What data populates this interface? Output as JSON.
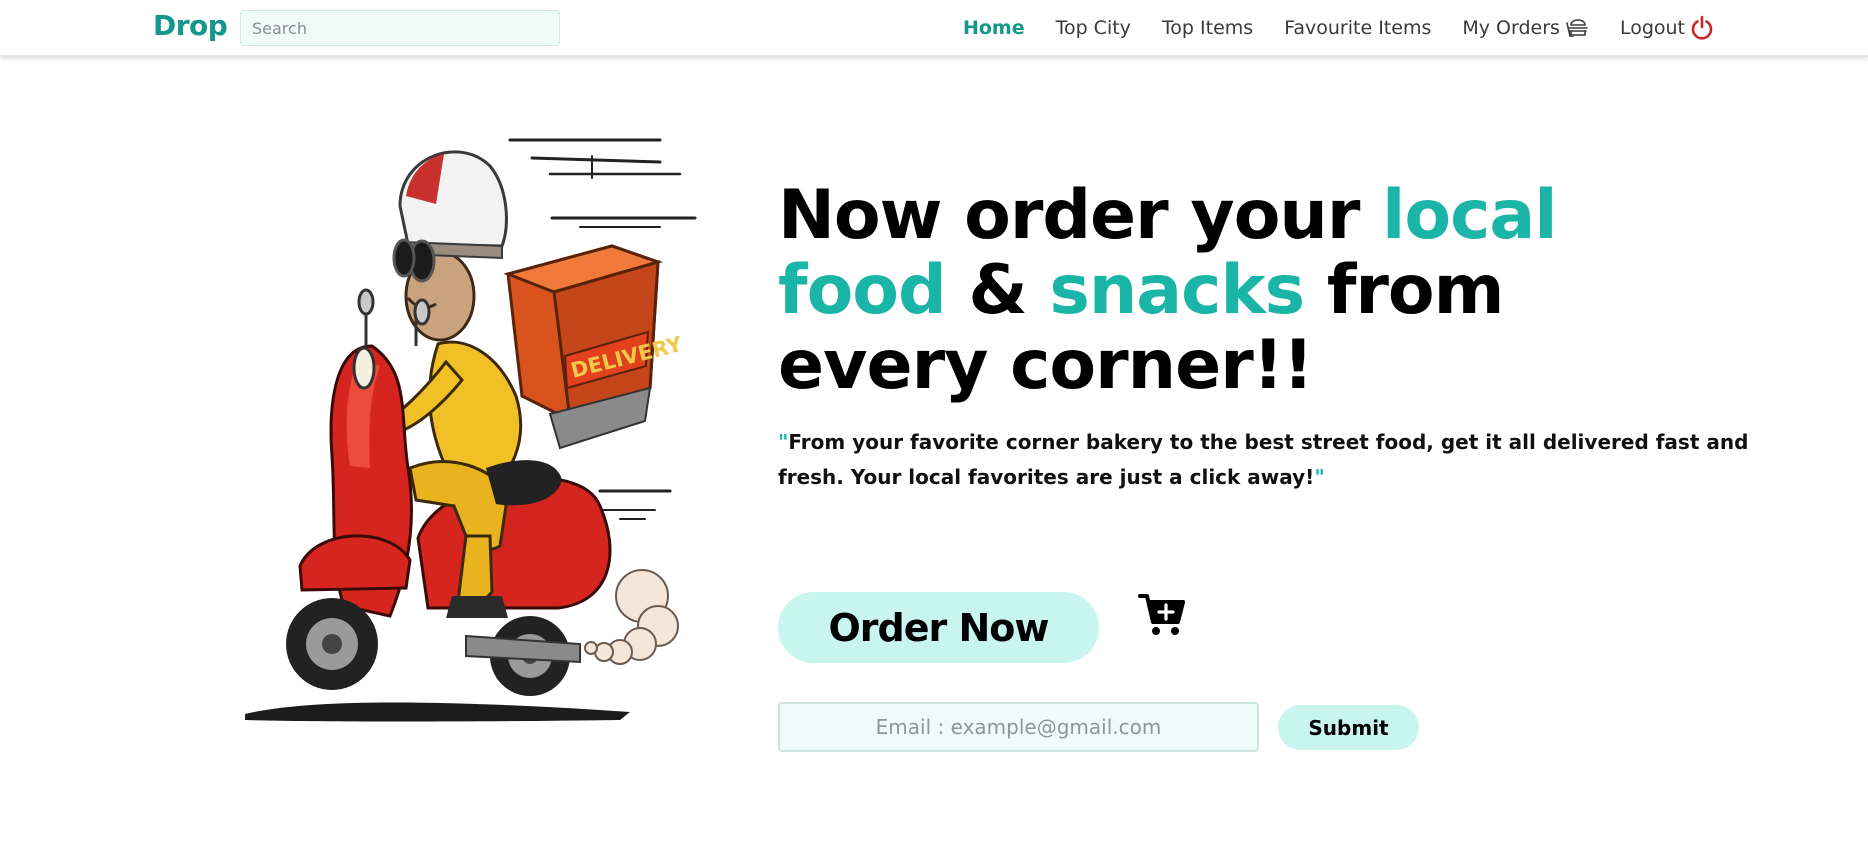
{
  "colors": {
    "brand": "#14968a",
    "accent": "#1ab5a6",
    "button_bg": "#c8f6ee",
    "logout_icon": "#c62828",
    "text_dark": "#000000"
  },
  "header": {
    "brand": "Drop",
    "search": {
      "placeholder": "Search",
      "value": ""
    },
    "nav": [
      {
        "label": "Home",
        "active": true
      },
      {
        "label": "Top City",
        "active": false
      },
      {
        "label": "Top Items",
        "active": false
      },
      {
        "label": "Favourite Items",
        "active": false
      },
      {
        "label": "My Orders",
        "active": false,
        "icon": "burger-icon"
      },
      {
        "label": "Logout",
        "active": false,
        "icon": "power-icon"
      }
    ]
  },
  "hero": {
    "image_icon": "delivery-scooter-illustration",
    "image_text": "DELIVERY",
    "headline": {
      "p1": "Now order your ",
      "p2": "local",
      "p3": "food",
      "p4": " & ",
      "p5": "snacks",
      "p6": " from",
      "p7": "every corner!!"
    },
    "quote": {
      "open": "\"",
      "text": "From your favorite corner bakery to the best street food, get it all delivered fast and fresh. Your local favorites are just a click away!",
      "close": "\""
    },
    "order_button": "Order Now",
    "cart_icon": "add-to-cart-icon",
    "email": {
      "placeholder": "Email : example@gmail.com",
      "value": ""
    },
    "submit_button": "Submit"
  }
}
